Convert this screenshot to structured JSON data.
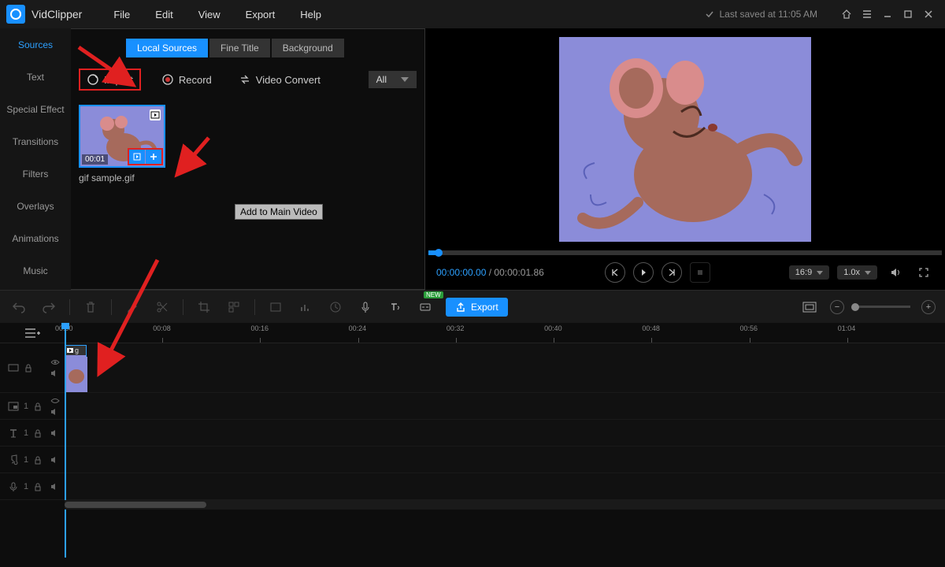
{
  "app": {
    "name": "VidClipper"
  },
  "menu": [
    "File",
    "Edit",
    "View",
    "Export",
    "Help"
  ],
  "save_status": "Last saved at 11:05 AM",
  "sidebar": {
    "items": [
      {
        "label": "Sources"
      },
      {
        "label": "Text"
      },
      {
        "label": "Special Effect"
      },
      {
        "label": "Transitions"
      },
      {
        "label": "Filters"
      },
      {
        "label": "Overlays"
      },
      {
        "label": "Animations"
      },
      {
        "label": "Music"
      }
    ],
    "active_index": 0
  },
  "sources_panel": {
    "tabs": [
      "Local Sources",
      "Fine Title",
      "Background"
    ],
    "active_tab": 0,
    "actions": {
      "import": "Import",
      "record": "Record",
      "video_convert": "Video Convert"
    },
    "filter_value": "All",
    "thumb": {
      "duration": "00:01",
      "name": "gif sample.gif"
    },
    "tooltip": "Add to Main Video"
  },
  "preview": {
    "current_time": "00:00:00.00",
    "total_time": "00:00:01.86",
    "aspect": "16:9",
    "speed": "1.0x"
  },
  "toolbar": {
    "export": "Export",
    "new_badge": "NEW"
  },
  "ruler": [
    "00:00",
    "00:08",
    "00:16",
    "00:24",
    "00:32",
    "00:40",
    "00:48",
    "00:56",
    "01:04"
  ],
  "clip": {
    "label": "g"
  },
  "track_counts": {
    "overlay": "1",
    "text": "1",
    "audio1": "1",
    "audio2": "1"
  }
}
